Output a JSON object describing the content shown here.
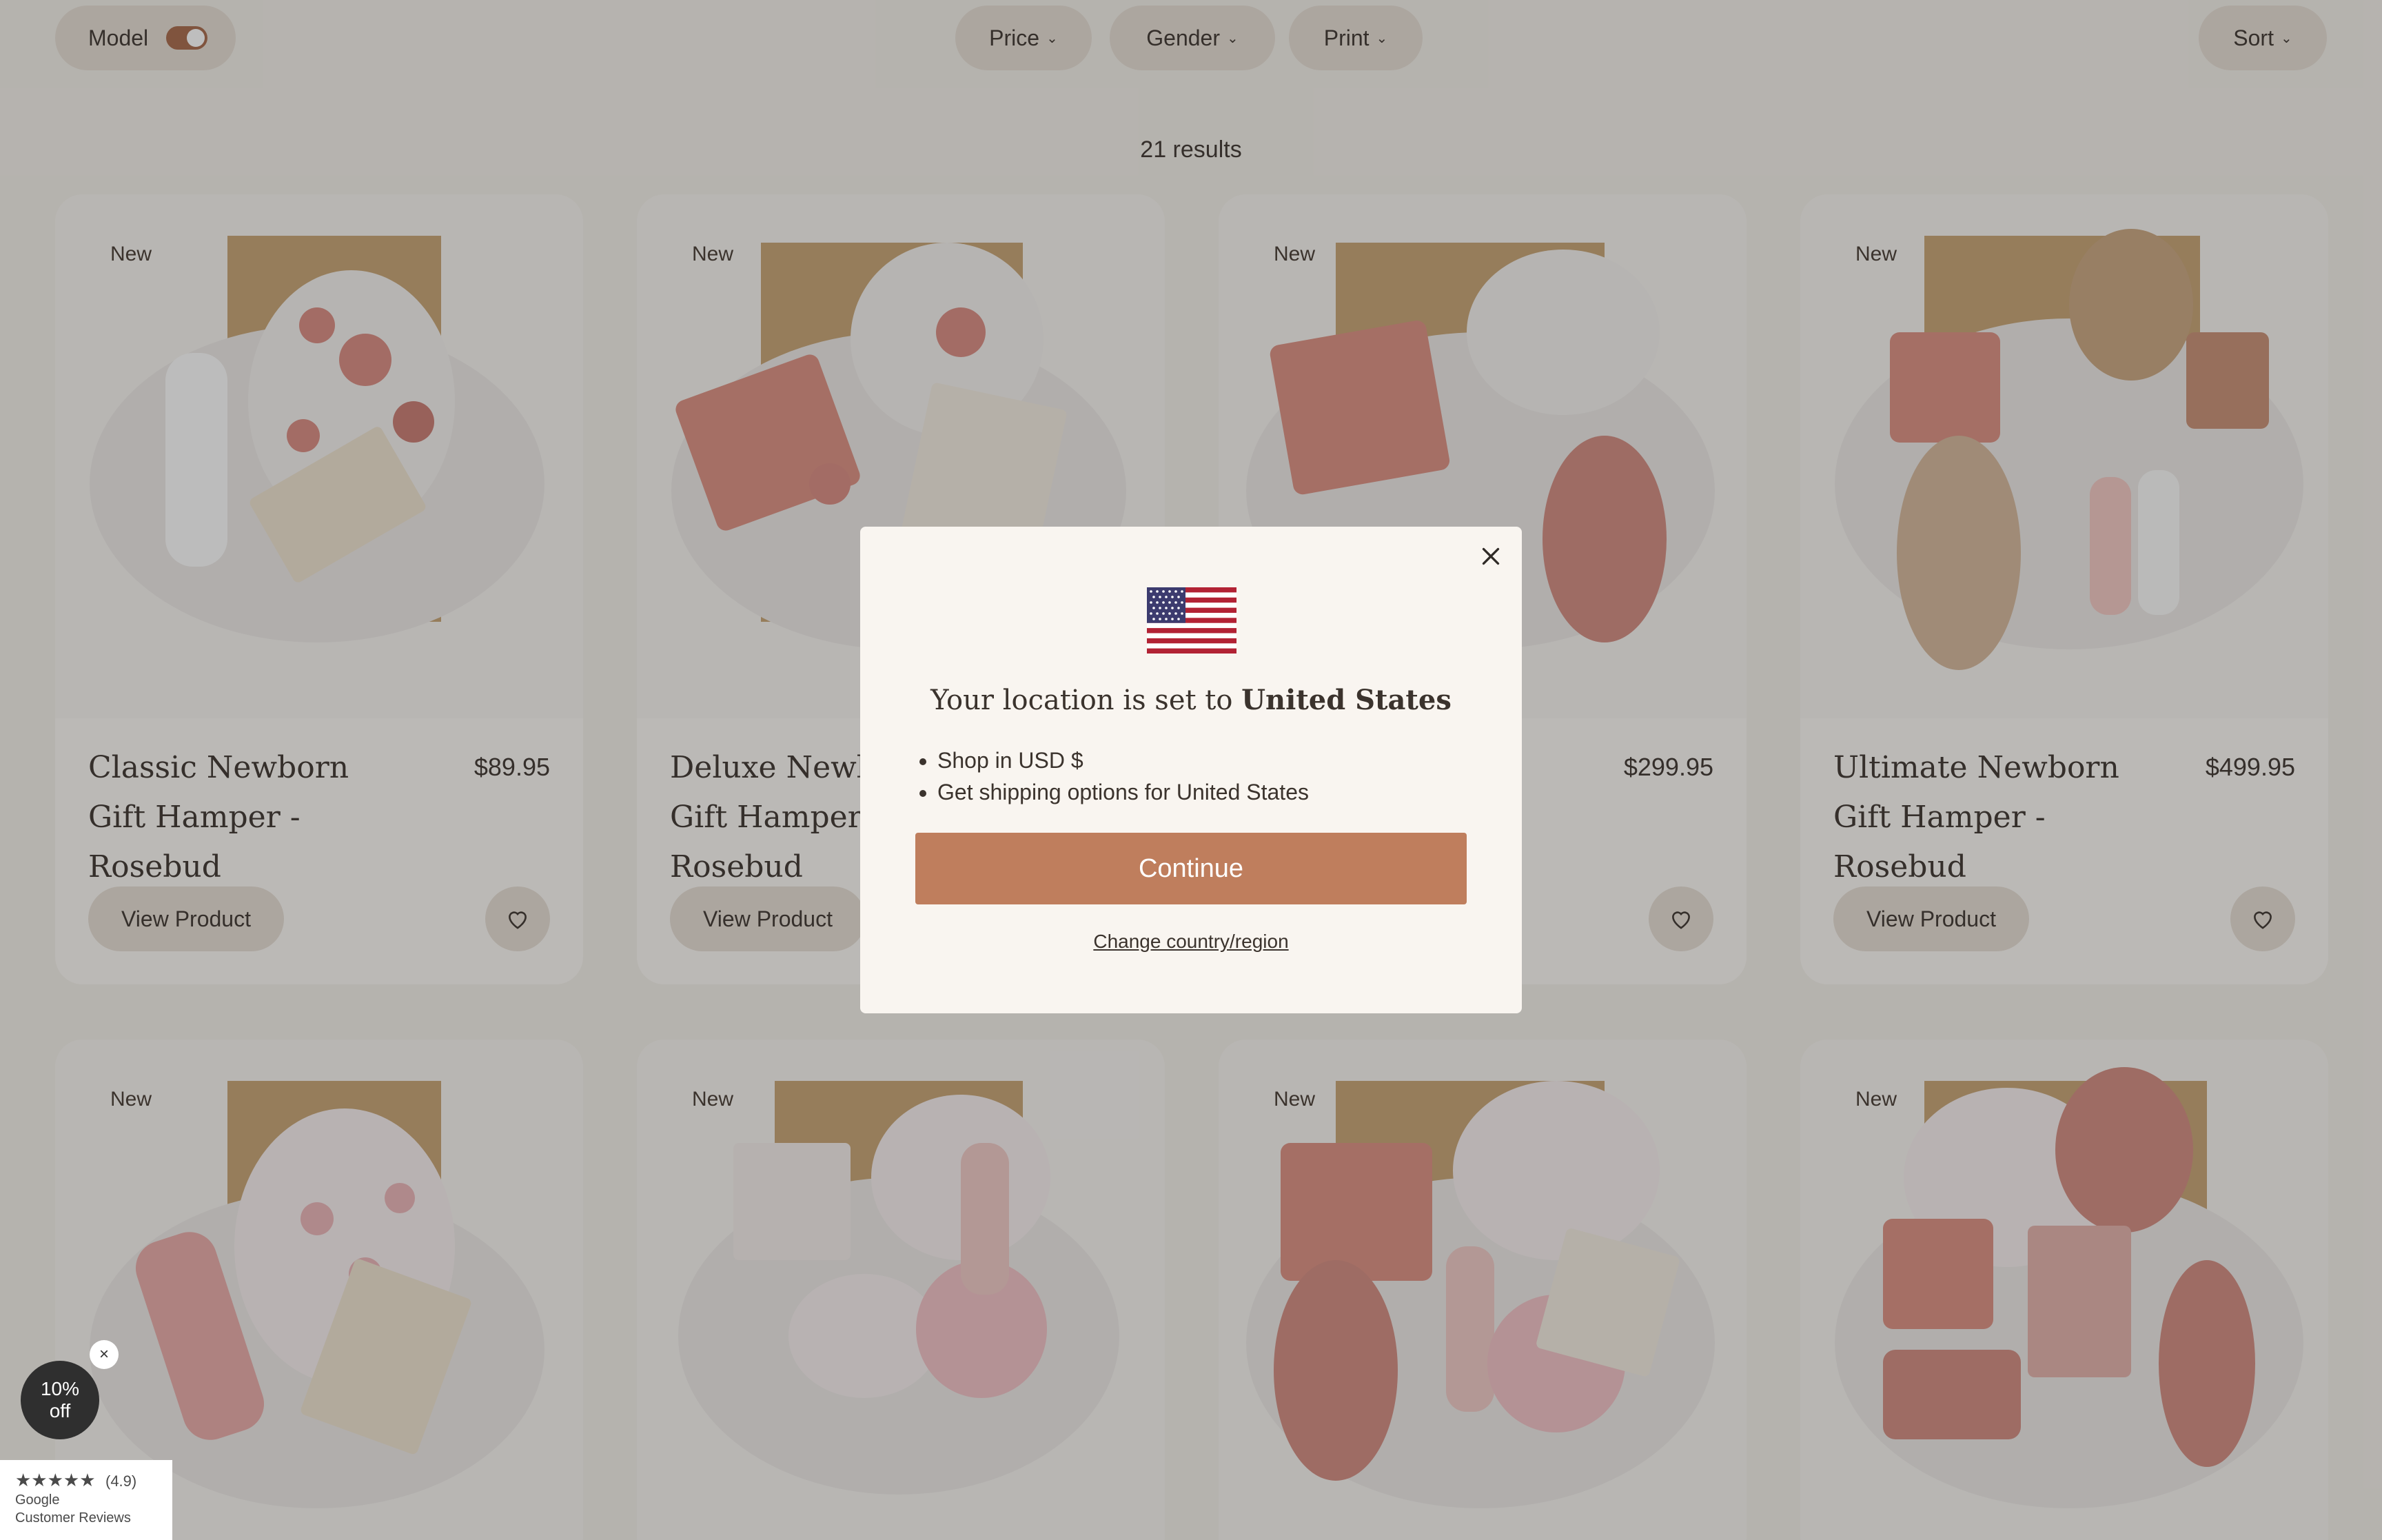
{
  "filters": {
    "model_label": "Model",
    "price_label": "Price",
    "gender_label": "Gender",
    "print_label": "Print",
    "sort_label": "Sort"
  },
  "results_text": "21 results",
  "products": [
    {
      "badge": "New",
      "name": "Classic Newborn Gift Hamper - Rosebud",
      "price": "$89.95",
      "button": "View Product"
    },
    {
      "badge": "New",
      "name": "Deluxe Newborn Gift Hamper - Rosebud",
      "price": "",
      "button": "View Product"
    },
    {
      "badge": "New",
      "name": "",
      "price": "$299.95",
      "button": ""
    },
    {
      "badge": "New",
      "name": "Ultimate Newborn Gift Hamper - Rosebud",
      "price": "$499.95",
      "button": "View Product"
    },
    {
      "badge": "New"
    },
    {
      "badge": "New"
    },
    {
      "badge": "New"
    },
    {
      "badge": "New"
    }
  ],
  "modal": {
    "title_prefix": "Your location is set to",
    "country": "United States",
    "bullets": [
      "Shop in USD $",
      "Get shipping options for United States"
    ],
    "continue_label": "Continue",
    "change_label": "Change country/region"
  },
  "discount": {
    "line1": "10%",
    "line2": "off",
    "close": "×"
  },
  "reviews": {
    "stars": "★★★★★",
    "rating": "(4.9)",
    "line1": "Google",
    "line2": "Customer Reviews"
  },
  "colors": {
    "accent": "#bf7e5d",
    "toggle": "#a76848",
    "pill": "#e6ddd3"
  }
}
